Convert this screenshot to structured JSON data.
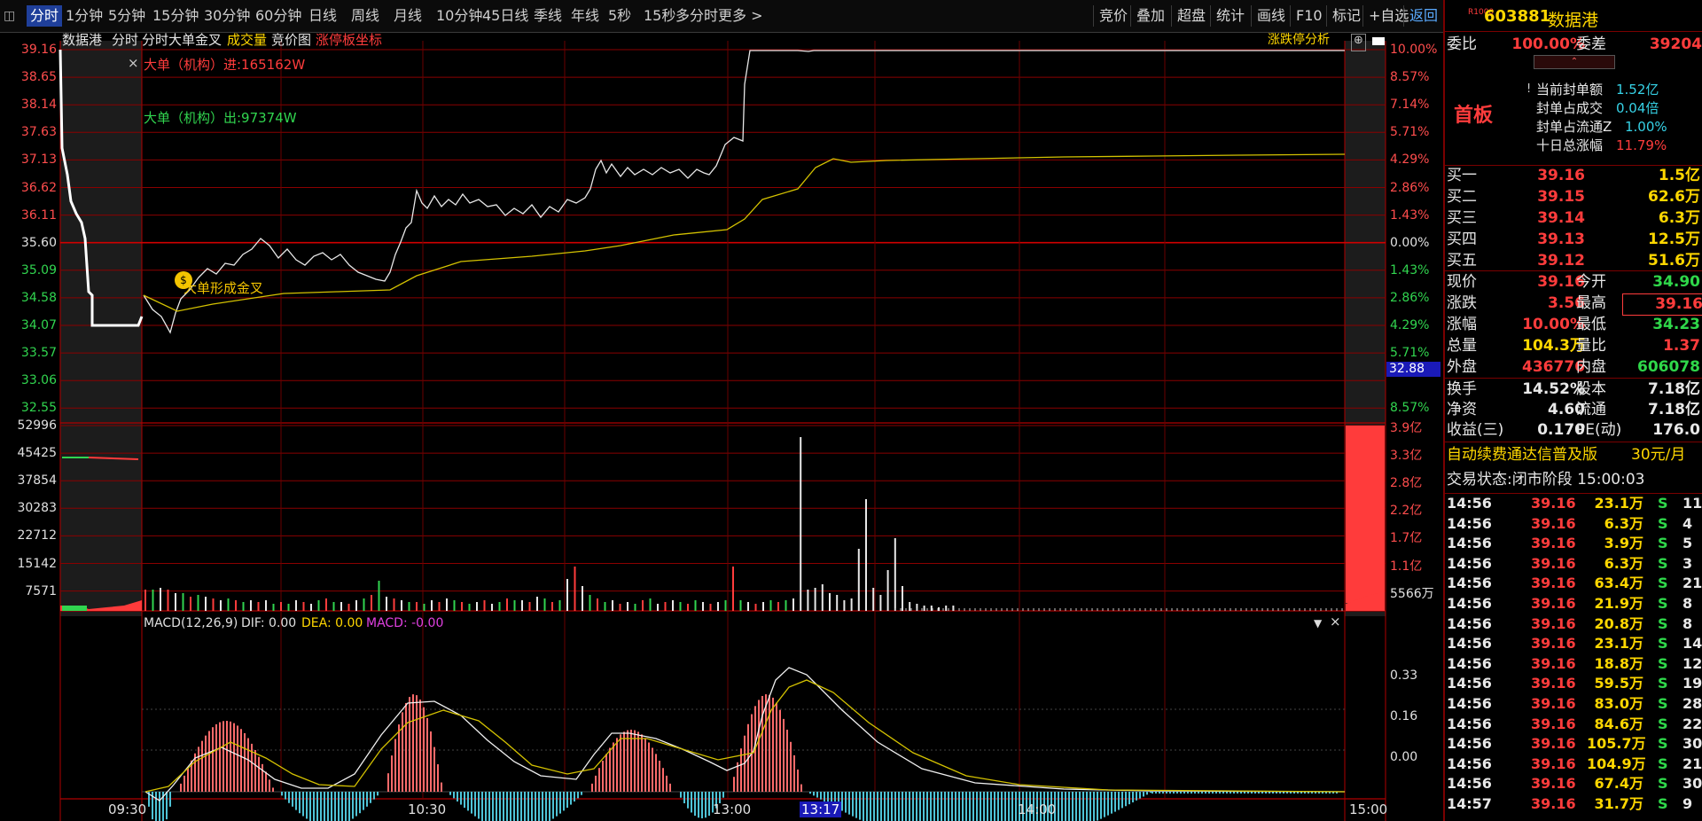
{
  "toolbar": {
    "tabs": [
      "分时",
      "1分钟",
      "5分钟",
      "15分钟",
      "30分钟",
      "60分钟",
      "日线",
      "周线",
      "月线",
      "10分钟",
      "45日线",
      "季线",
      "年线",
      "5秒",
      "15秒",
      "多分时",
      "更多 >"
    ],
    "right_buttons": [
      "竞价",
      "叠加",
      "超盘",
      "统计",
      "画线",
      "F10",
      "标记",
      "+自选",
      "返回"
    ]
  },
  "chart": {
    "stock_label": "数据港",
    "header_items": [
      "分时",
      "分时大单金叉",
      "成交量",
      "竞价图",
      "涨停板坐标"
    ],
    "analysis_button": "涨跌停分析",
    "big_in": "大单（机构）进:165162W",
    "big_out": "大单（机构）出:97374W",
    "golden_cross": "大单形成金叉",
    "price_axis_left": [
      "39.16",
      "38.65",
      "38.14",
      "37.63",
      "37.13",
      "36.62",
      "36.11",
      "35.60",
      "35.09",
      "34.58",
      "34.07",
      "33.57",
      "33.06",
      "32.55"
    ],
    "pct_axis_right": [
      "10.00%",
      "8.57%",
      "7.14%",
      "5.71%",
      "4.29%",
      "2.86%",
      "1.43%",
      "0.00%",
      "1.43%",
      "2.86%",
      "4.29%",
      "5.71%",
      "",
      "8.57%"
    ],
    "price_tag": "32.88",
    "volume_axis_left": [
      "52996",
      "45425",
      "37854",
      "30283",
      "22712",
      "15142",
      "7571"
    ],
    "volume_axis_right": [
      "3.9亿",
      "3.3亿",
      "2.8亿",
      "2.2亿",
      "1.7亿",
      "1.1亿",
      "5566万"
    ],
    "macd_label": "MACD(12,26,9)",
    "dif_label": "DIF: 0.00",
    "dea_label": "DEA: 0.00",
    "macd_value_label": "MACD: -0.00",
    "macd_axis": [
      "0.33",
      "0.16",
      "0.00"
    ],
    "time_labels": [
      "09:30",
      "10:30",
      "13:00",
      "13:17",
      "14:00",
      "15:00"
    ]
  },
  "panel": {
    "code": "603881",
    "name": "数据港",
    "rank_badge": "R1000",
    "weibi_label": "委比",
    "weibi_value": "100.00%",
    "weicha_label": "委差",
    "weicha_value": "39204",
    "board_label": "首板",
    "seal_rows": [
      {
        "label": "当前封单额",
        "value": "1.52亿"
      },
      {
        "label": "封单占成交",
        "value": "0.04倍"
      },
      {
        "label": "封单占流通Z",
        "value": "1.00%"
      },
      {
        "label": "十日总涨幅",
        "value": "11.79%"
      }
    ],
    "bids": [
      {
        "label": "买一",
        "price": "39.16",
        "vol": "1.5亿"
      },
      {
        "label": "买二",
        "price": "39.15",
        "vol": "62.6万"
      },
      {
        "label": "买三",
        "price": "39.14",
        "vol": "6.3万"
      },
      {
        "label": "买四",
        "price": "39.13",
        "vol": "12.5万"
      },
      {
        "label": "买五",
        "price": "39.12",
        "vol": "51.6万"
      }
    ],
    "quote": [
      {
        "l1": "现价",
        "v1": "39.16",
        "l2": "今开",
        "v2": "34.90"
      },
      {
        "l1": "涨跌",
        "v1": "3.56",
        "l2": "最高",
        "v2": "39.16"
      },
      {
        "l1": "涨幅",
        "v1": "10.00%",
        "l2": "最低",
        "v2": "34.23"
      },
      {
        "l1": "总量",
        "v1": "104.3万",
        "l2": "量比",
        "v2": "1.37"
      },
      {
        "l1": "外盘",
        "v1": "436776",
        "l2": "内盘",
        "v2": "606078"
      }
    ],
    "finance": [
      {
        "l1": "换手",
        "v1": "14.52%",
        "l2": "股本",
        "v2": "7.18亿"
      },
      {
        "l1": "净资",
        "v1": "4.60",
        "l2": "流通",
        "v2": "7.18亿"
      },
      {
        "l1": "收益(三)",
        "v1": "0.170",
        "l2": "PE(动)",
        "v2": "176.0"
      }
    ],
    "promo": "自动续费通达信普及版",
    "promo_price": "30元/月",
    "status": "交易状态:闭市阶段 15:00:03",
    "ticks": [
      {
        "t": "14:56",
        "p": "39.16",
        "v": "23.1万",
        "s": "S",
        "n": "11"
      },
      {
        "t": "14:56",
        "p": "39.16",
        "v": "6.3万",
        "s": "S",
        "n": "4"
      },
      {
        "t": "14:56",
        "p": "39.16",
        "v": "3.9万",
        "s": "S",
        "n": "5"
      },
      {
        "t": "14:56",
        "p": "39.16",
        "v": "6.3万",
        "s": "S",
        "n": "3"
      },
      {
        "t": "14:56",
        "p": "39.16",
        "v": "63.4万",
        "s": "S",
        "n": "21"
      },
      {
        "t": "14:56",
        "p": "39.16",
        "v": "21.9万",
        "s": "S",
        "n": "8"
      },
      {
        "t": "14:56",
        "p": "39.16",
        "v": "20.8万",
        "s": "S",
        "n": "8"
      },
      {
        "t": "14:56",
        "p": "39.16",
        "v": "23.1万",
        "s": "S",
        "n": "14"
      },
      {
        "t": "14:56",
        "p": "39.16",
        "v": "18.8万",
        "s": "S",
        "n": "12"
      },
      {
        "t": "14:56",
        "p": "39.16",
        "v": "59.5万",
        "s": "S",
        "n": "19"
      },
      {
        "t": "14:56",
        "p": "39.16",
        "v": "83.0万",
        "s": "S",
        "n": "28"
      },
      {
        "t": "14:56",
        "p": "39.16",
        "v": "84.6万",
        "s": "S",
        "n": "22"
      },
      {
        "t": "14:56",
        "p": "39.16",
        "v": "105.7万",
        "s": "S",
        "n": "30"
      },
      {
        "t": "14:56",
        "p": "39.16",
        "v": "104.9万",
        "s": "S",
        "n": "21"
      },
      {
        "t": "14:56",
        "p": "39.16",
        "v": "67.4万",
        "s": "S",
        "n": "30"
      },
      {
        "t": "14:57",
        "p": "39.16",
        "v": "31.7万",
        "s": "S",
        "n": "9"
      }
    ]
  }
}
